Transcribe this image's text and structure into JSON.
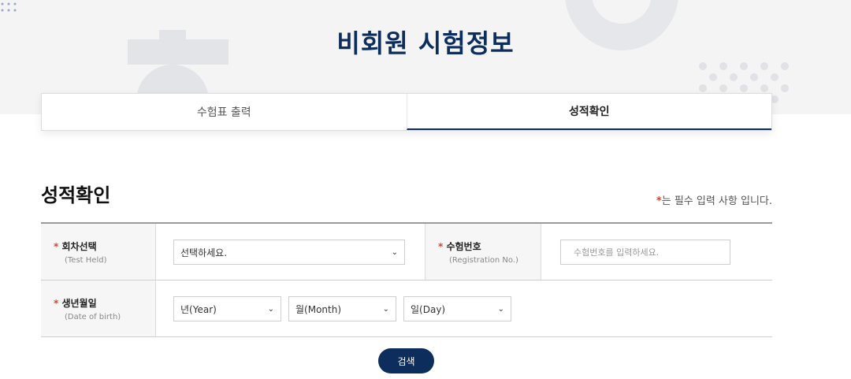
{
  "header": {
    "title": "비회원 시험정보"
  },
  "tabs": [
    {
      "label": "수험표 출력",
      "active": false
    },
    {
      "label": "성적확인",
      "active": true
    }
  ],
  "section": {
    "title": "성적확인",
    "required_star": "*",
    "required_note": "는 필수 입력 사항 입니다."
  },
  "form": {
    "test_held": {
      "star": "*",
      "label": "회차선택",
      "sub": "(Test Held)",
      "value": "선택하세요."
    },
    "registration": {
      "star": "*",
      "label": "수험번호",
      "sub": "(Registration No.)",
      "placeholder": "수험번호를 입력하세요."
    },
    "birth": {
      "star": "*",
      "label": "생년월일",
      "sub": "(Date of birth)",
      "year": "년(Year)",
      "month": "월(Month)",
      "day": "일(Day)"
    }
  },
  "search_button": {
    "label": "검색"
  },
  "colors": {
    "navy": "#0d2d5c",
    "required": "#d9442f",
    "highlight": "#c6dcf0"
  }
}
